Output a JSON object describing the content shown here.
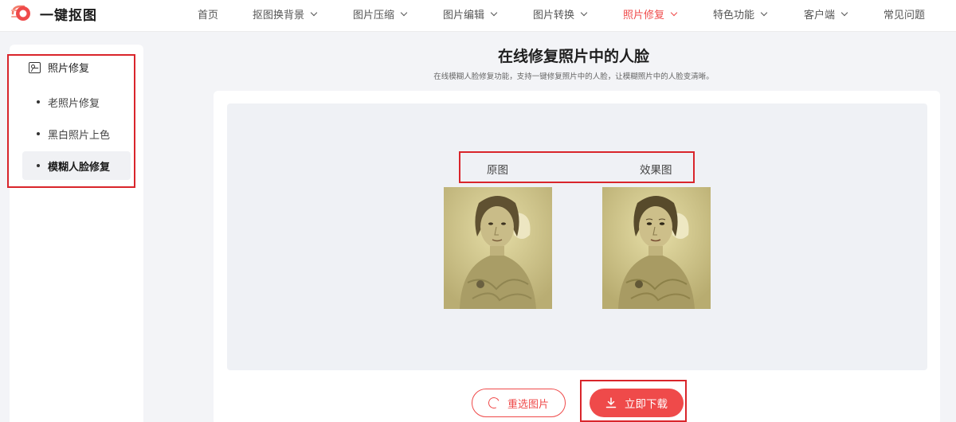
{
  "brand": {
    "name": "一键抠图",
    "accent": "#ef4a4a"
  },
  "nav": [
    {
      "label": "首页",
      "dropdown": false,
      "active": false
    },
    {
      "label": "抠图换背景",
      "dropdown": true,
      "active": false
    },
    {
      "label": "图片压缩",
      "dropdown": true,
      "active": false
    },
    {
      "label": "图片编辑",
      "dropdown": true,
      "active": false
    },
    {
      "label": "图片转换",
      "dropdown": true,
      "active": false
    },
    {
      "label": "照片修复",
      "dropdown": true,
      "active": true
    },
    {
      "label": "特色功能",
      "dropdown": true,
      "active": false
    },
    {
      "label": "客户端",
      "dropdown": true,
      "active": false
    },
    {
      "label": "常见问题",
      "dropdown": false,
      "active": false
    }
  ],
  "sidebar": {
    "heading": "照片修复",
    "items": [
      {
        "label": "老照片修复",
        "active": false
      },
      {
        "label": "黑白照片上色",
        "active": false
      },
      {
        "label": "模糊人脸修复",
        "active": true
      }
    ]
  },
  "main": {
    "title": "在线修复照片中的人脸",
    "subtitle": "在线模糊人脸修复功能，支持一键修复照片中的人脸，让模糊照片中的人脸变清晰。",
    "original_label": "原图",
    "result_label": "效果图"
  },
  "actions": {
    "reselect_label": "重选图片",
    "download_label": "立即下载"
  }
}
